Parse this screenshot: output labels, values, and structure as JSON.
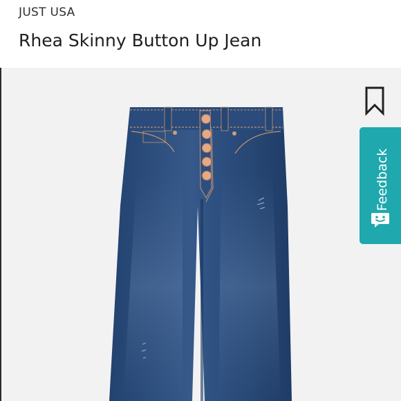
{
  "product": {
    "brand": "JUST USA",
    "title": "Rhea Skinny Button Up Jean"
  },
  "actions": {
    "bookmark_icon": "bookmark-icon",
    "feedback_label": "Feedback",
    "feedback_icon": "smiley-chat-icon"
  },
  "colors": {
    "accent": "#1fa8ae",
    "denim": "#2c4f7f",
    "denim_dark": "#1f3c66",
    "button_copper": "#e0a582",
    "background": "#f2f2f2"
  }
}
